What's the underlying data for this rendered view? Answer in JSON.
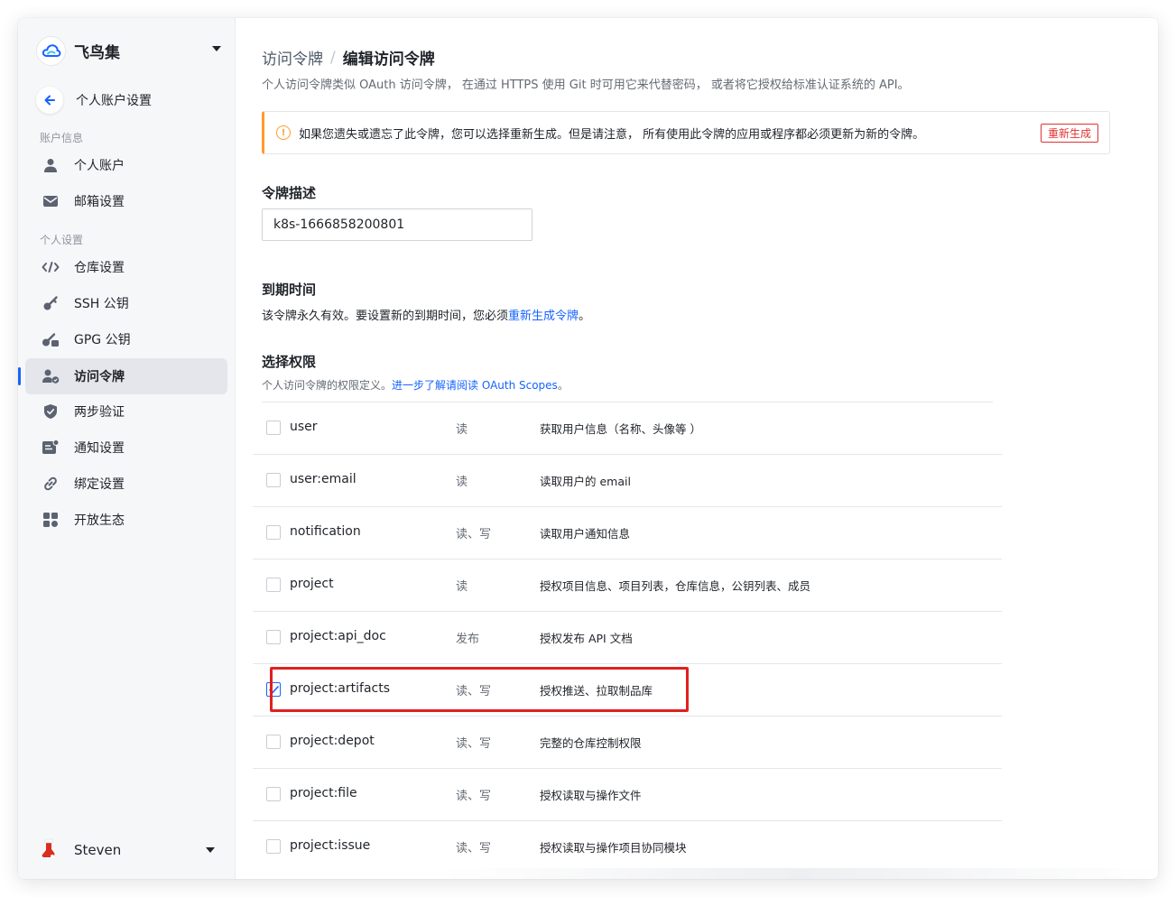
{
  "brand": {
    "name": "飞鸟集"
  },
  "sidebar": {
    "back_label": "个人账户设置",
    "section_account": "账户信息",
    "section_personal": "个人设置",
    "items": [
      {
        "label": "个人账户",
        "icon": "user-icon"
      },
      {
        "label": "邮箱设置",
        "icon": "mail-icon"
      },
      {
        "label": "仓库设置",
        "icon": "code-icon"
      },
      {
        "label": "SSH 公钥",
        "icon": "key-icon"
      },
      {
        "label": "GPG 公钥",
        "icon": "gpg-key-icon"
      },
      {
        "label": "访问令牌",
        "icon": "token-user-icon",
        "active": true
      },
      {
        "label": "两步验证",
        "icon": "shield-icon"
      },
      {
        "label": "通知设置",
        "icon": "notification-icon"
      },
      {
        "label": "绑定设置",
        "icon": "link-icon"
      },
      {
        "label": "开放生态",
        "icon": "apps-icon"
      }
    ],
    "user": {
      "name": "Steven"
    }
  },
  "header": {
    "breadcrumb_parent": "访问令牌",
    "breadcrumb_sep": "/",
    "breadcrumb_current": "编辑访问令牌",
    "subtitle": "个人访问令牌类似 OAuth 访问令牌， 在通过 HTTPS 使用 Git 时可用它来代替密码， 或者将它授权给标准认证系统的 API。"
  },
  "alert": {
    "icon_glyph": "!",
    "text": "如果您遗失或遗忘了此令牌，您可以选择重新生成。但是请注意， 所有使用此令牌的应用或程序都必须更新为新的令牌。",
    "button": "重新生成"
  },
  "token_desc": {
    "title": "令牌描述",
    "value": "k8s-1666858200801"
  },
  "expire": {
    "title": "到期时间",
    "text_before": "该令牌永久有效。要设置新的到期时间，您必须",
    "link": "重新生成令牌",
    "text_after": "。"
  },
  "permissions": {
    "title": "选择权限",
    "desc_before": "个人访问令牌的权限定义。",
    "desc_link": "进一步了解请阅读 OAuth Scopes",
    "desc_after": "。",
    "rows": [
      {
        "name": "user",
        "access": "读",
        "info": "获取用户信息（名称、头像等 ）",
        "checked": false
      },
      {
        "name": "user:email",
        "access": "读",
        "info": "读取用户的 email",
        "checked": false
      },
      {
        "name": "notification",
        "access": "读、写",
        "info": "读取用户通知信息",
        "checked": false
      },
      {
        "name": "project",
        "access": "读",
        "info": "授权项目信息、项目列表，仓库信息，公钥列表、成员",
        "checked": false
      },
      {
        "name": "project:api_doc",
        "access": "发布",
        "info": "授权发布 API 文档",
        "checked": false
      },
      {
        "name": "project:artifacts",
        "access": "读、写",
        "info": "授权推送、拉取制品库",
        "checked": true
      },
      {
        "name": "project:depot",
        "access": "读、写",
        "info": "完整的仓库控制权限",
        "checked": false
      },
      {
        "name": "project:file",
        "access": "读、写",
        "info": "授权读取与操作文件",
        "checked": false
      },
      {
        "name": "project:issue",
        "access": "读、写",
        "info": "授权读取与操作项目协同模块",
        "checked": false
      }
    ]
  }
}
